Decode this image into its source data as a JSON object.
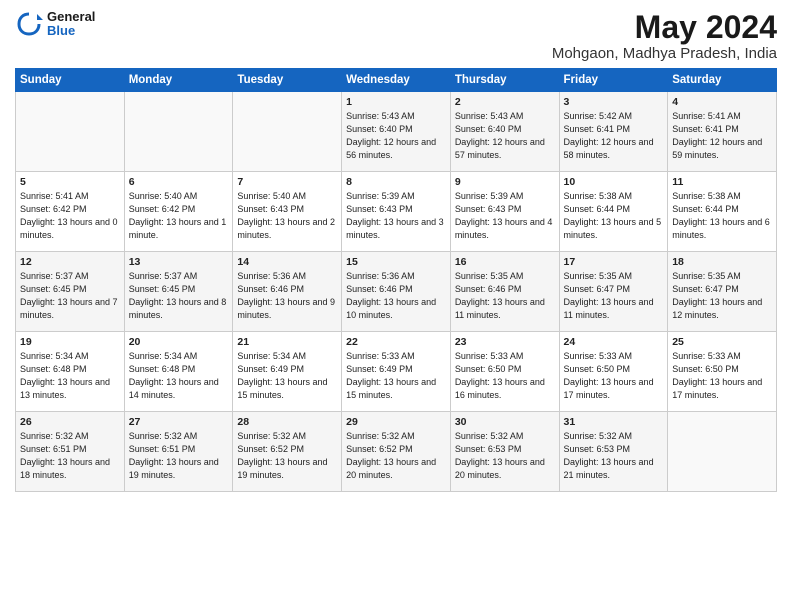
{
  "logo": {
    "general": "General",
    "blue": "Blue"
  },
  "header": {
    "month_year": "May 2024",
    "location": "Mohgaon, Madhya Pradesh, India"
  },
  "days_of_week": [
    "Sunday",
    "Monday",
    "Tuesday",
    "Wednesday",
    "Thursday",
    "Friday",
    "Saturday"
  ],
  "weeks": [
    [
      {
        "day": "",
        "info": ""
      },
      {
        "day": "",
        "info": ""
      },
      {
        "day": "",
        "info": ""
      },
      {
        "day": "1",
        "info": "Sunrise: 5:43 AM\nSunset: 6:40 PM\nDaylight: 12 hours\nand 56 minutes."
      },
      {
        "day": "2",
        "info": "Sunrise: 5:43 AM\nSunset: 6:40 PM\nDaylight: 12 hours\nand 57 minutes."
      },
      {
        "day": "3",
        "info": "Sunrise: 5:42 AM\nSunset: 6:41 PM\nDaylight: 12 hours\nand 58 minutes."
      },
      {
        "day": "4",
        "info": "Sunrise: 5:41 AM\nSunset: 6:41 PM\nDaylight: 12 hours\nand 59 minutes."
      }
    ],
    [
      {
        "day": "5",
        "info": "Sunrise: 5:41 AM\nSunset: 6:42 PM\nDaylight: 13 hours\nand 0 minutes."
      },
      {
        "day": "6",
        "info": "Sunrise: 5:40 AM\nSunset: 6:42 PM\nDaylight: 13 hours\nand 1 minute."
      },
      {
        "day": "7",
        "info": "Sunrise: 5:40 AM\nSunset: 6:43 PM\nDaylight: 13 hours\nand 2 minutes."
      },
      {
        "day": "8",
        "info": "Sunrise: 5:39 AM\nSunset: 6:43 PM\nDaylight: 13 hours\nand 3 minutes."
      },
      {
        "day": "9",
        "info": "Sunrise: 5:39 AM\nSunset: 6:43 PM\nDaylight: 13 hours\nand 4 minutes."
      },
      {
        "day": "10",
        "info": "Sunrise: 5:38 AM\nSunset: 6:44 PM\nDaylight: 13 hours\nand 5 minutes."
      },
      {
        "day": "11",
        "info": "Sunrise: 5:38 AM\nSunset: 6:44 PM\nDaylight: 13 hours\nand 6 minutes."
      }
    ],
    [
      {
        "day": "12",
        "info": "Sunrise: 5:37 AM\nSunset: 6:45 PM\nDaylight: 13 hours\nand 7 minutes."
      },
      {
        "day": "13",
        "info": "Sunrise: 5:37 AM\nSunset: 6:45 PM\nDaylight: 13 hours\nand 8 minutes."
      },
      {
        "day": "14",
        "info": "Sunrise: 5:36 AM\nSunset: 6:46 PM\nDaylight: 13 hours\nand 9 minutes."
      },
      {
        "day": "15",
        "info": "Sunrise: 5:36 AM\nSunset: 6:46 PM\nDaylight: 13 hours\nand 10 minutes."
      },
      {
        "day": "16",
        "info": "Sunrise: 5:35 AM\nSunset: 6:46 PM\nDaylight: 13 hours\nand 11 minutes."
      },
      {
        "day": "17",
        "info": "Sunrise: 5:35 AM\nSunset: 6:47 PM\nDaylight: 13 hours\nand 11 minutes."
      },
      {
        "day": "18",
        "info": "Sunrise: 5:35 AM\nSunset: 6:47 PM\nDaylight: 13 hours\nand 12 minutes."
      }
    ],
    [
      {
        "day": "19",
        "info": "Sunrise: 5:34 AM\nSunset: 6:48 PM\nDaylight: 13 hours\nand 13 minutes."
      },
      {
        "day": "20",
        "info": "Sunrise: 5:34 AM\nSunset: 6:48 PM\nDaylight: 13 hours\nand 14 minutes."
      },
      {
        "day": "21",
        "info": "Sunrise: 5:34 AM\nSunset: 6:49 PM\nDaylight: 13 hours\nand 15 minutes."
      },
      {
        "day": "22",
        "info": "Sunrise: 5:33 AM\nSunset: 6:49 PM\nDaylight: 13 hours\nand 15 minutes."
      },
      {
        "day": "23",
        "info": "Sunrise: 5:33 AM\nSunset: 6:50 PM\nDaylight: 13 hours\nand 16 minutes."
      },
      {
        "day": "24",
        "info": "Sunrise: 5:33 AM\nSunset: 6:50 PM\nDaylight: 13 hours\nand 17 minutes."
      },
      {
        "day": "25",
        "info": "Sunrise: 5:33 AM\nSunset: 6:50 PM\nDaylight: 13 hours\nand 17 minutes."
      }
    ],
    [
      {
        "day": "26",
        "info": "Sunrise: 5:32 AM\nSunset: 6:51 PM\nDaylight: 13 hours\nand 18 minutes."
      },
      {
        "day": "27",
        "info": "Sunrise: 5:32 AM\nSunset: 6:51 PM\nDaylight: 13 hours\nand 19 minutes."
      },
      {
        "day": "28",
        "info": "Sunrise: 5:32 AM\nSunset: 6:52 PM\nDaylight: 13 hours\nand 19 minutes."
      },
      {
        "day": "29",
        "info": "Sunrise: 5:32 AM\nSunset: 6:52 PM\nDaylight: 13 hours\nand 20 minutes."
      },
      {
        "day": "30",
        "info": "Sunrise: 5:32 AM\nSunset: 6:53 PM\nDaylight: 13 hours\nand 20 minutes."
      },
      {
        "day": "31",
        "info": "Sunrise: 5:32 AM\nSunset: 6:53 PM\nDaylight: 13 hours\nand 21 minutes."
      },
      {
        "day": "",
        "info": ""
      }
    ]
  ]
}
